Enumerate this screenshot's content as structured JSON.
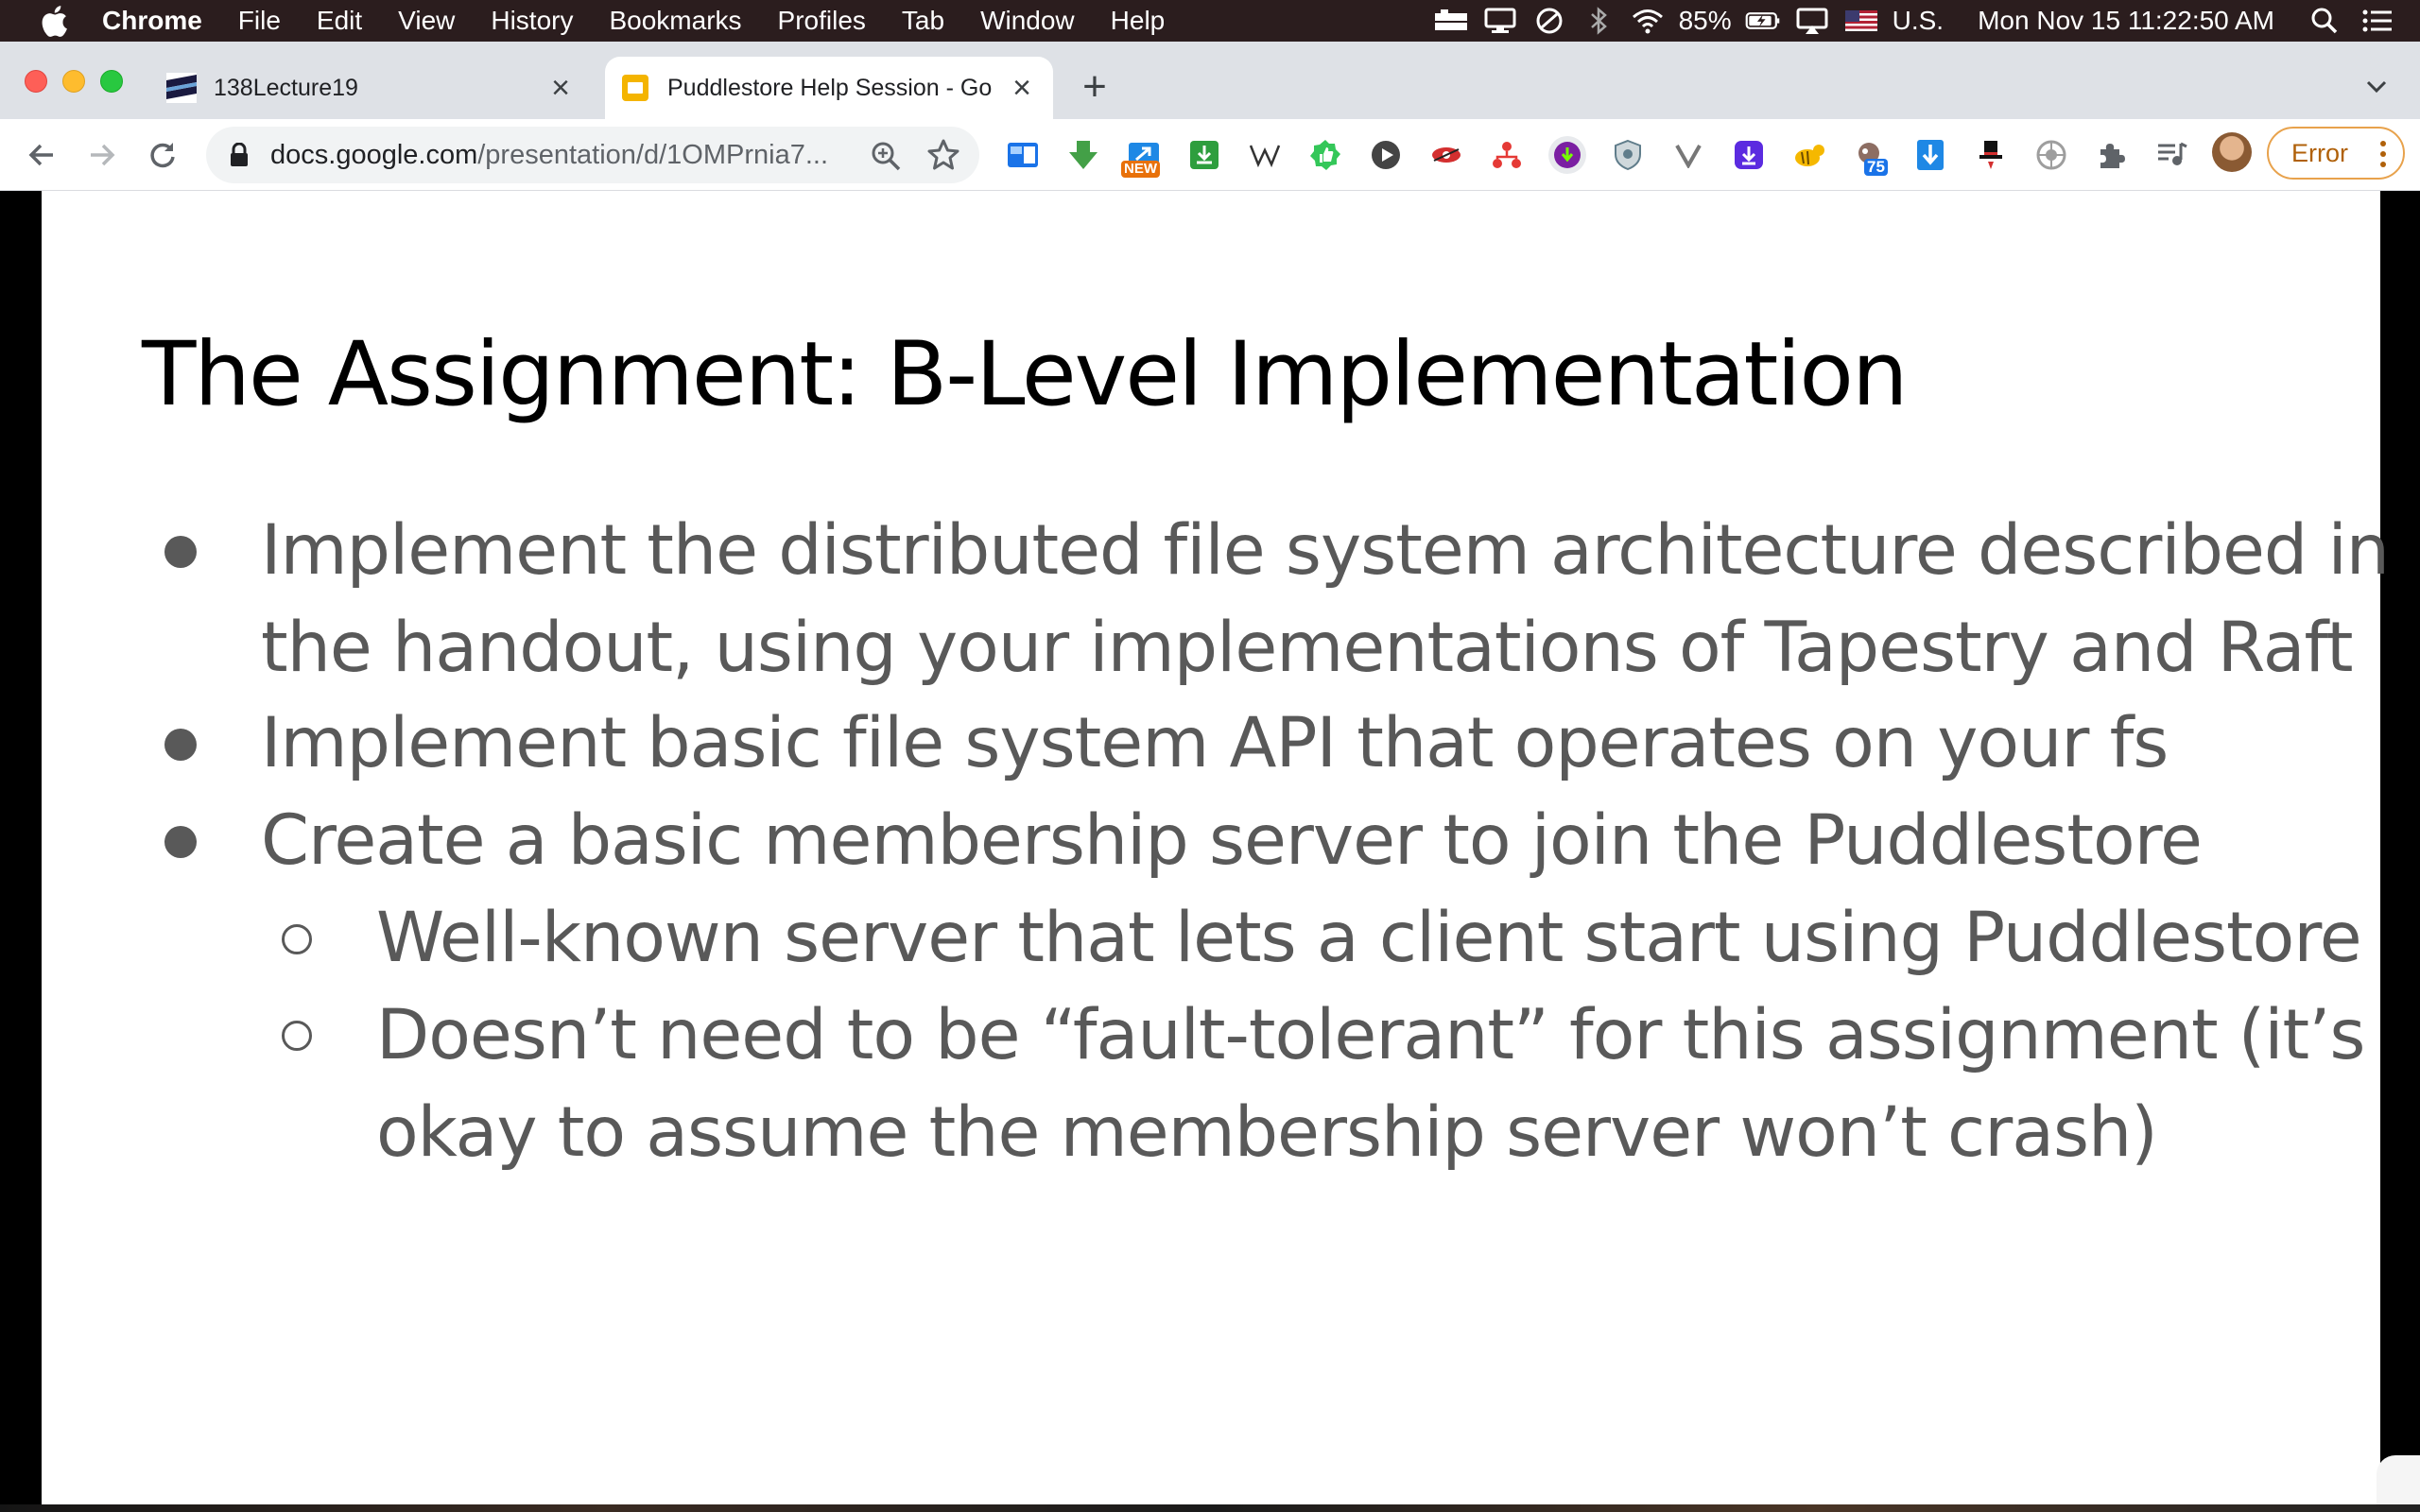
{
  "menubar": {
    "app_name": "Chrome",
    "menus": [
      "File",
      "Edit",
      "View",
      "History",
      "Bookmarks",
      "Profiles",
      "Tab",
      "Window",
      "Help"
    ],
    "battery": "85%",
    "input_source": "U.S.",
    "clock": "Mon Nov 15  11:22:50 AM"
  },
  "tabs": [
    {
      "title": "138Lecture19"
    },
    {
      "title": "Puddlestore Help Session - Go"
    }
  ],
  "toolbar": {
    "url_domain": "docs.google.com",
    "url_path": "/presentation/d/1OMPrnia7...",
    "extension_badges": {
      "new_label": "NEW",
      "count_label": "75"
    },
    "error_label": "Error"
  },
  "slide": {
    "title": "The Assignment: B-Level Implementation",
    "bullets": [
      {
        "lines": [
          "Implement the distributed file system architecture described in",
          "the handout, using your implementations of Tapestry and Raft"
        ]
      },
      {
        "lines": [
          "Implement basic file system API that operates on your fs"
        ]
      },
      {
        "lines": [
          "Create a basic membership server to join the Puddlestore"
        ]
      }
    ],
    "subbullets": [
      {
        "lines": [
          "Well-known server that lets a client start using Puddlestore"
        ]
      },
      {
        "lines": [
          "Doesn’t need to be “fault-tolerant” for this assignment (it’s",
          "okay to assume the membership server won’t crash)"
        ]
      }
    ]
  },
  "colors": {
    "menubar_bg": "#2b1d1e",
    "tabstrip_bg": "#dee1e6",
    "slide_text": "#595959",
    "slides_favicon": "#f4b400",
    "error_accent": "#e8a24c"
  }
}
